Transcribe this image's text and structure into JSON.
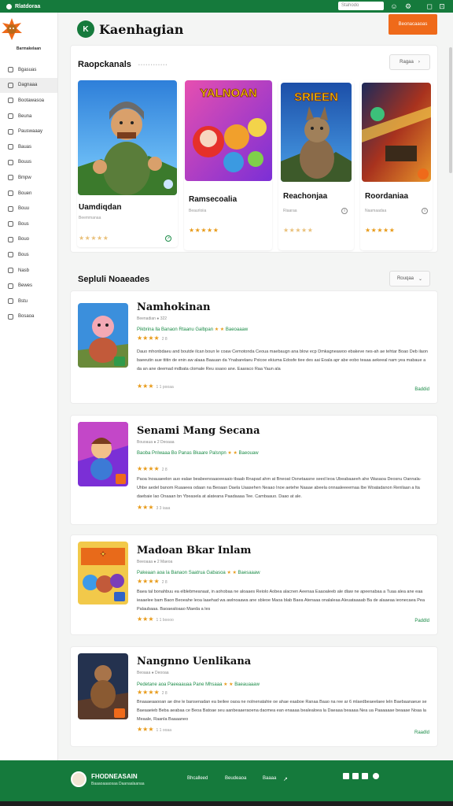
{
  "topbar": {
    "brand": "Rlatdoraa",
    "search_placeholder": "Stahodo"
  },
  "sidebar": {
    "logo_caption": "Barmakelaan",
    "items": [
      {
        "label": "Bgasuas"
      },
      {
        "label": "Dagnaaa"
      },
      {
        "label": "Bootawasoa"
      },
      {
        "label": "Beuna"
      },
      {
        "label": "Pauswaaay"
      },
      {
        "label": "Bauas"
      },
      {
        "label": "Bouus"
      },
      {
        "label": "Bmpw"
      },
      {
        "label": "Bouen"
      },
      {
        "label": "Bouu"
      },
      {
        "label": "Bous"
      },
      {
        "label": "Bouo"
      },
      {
        "label": "Bous"
      },
      {
        "label": "Nasb"
      },
      {
        "label": "Bewes"
      },
      {
        "label": "Bstu"
      },
      {
        "label": "Bosaoa"
      }
    ]
  },
  "header": {
    "title": "Kaenhagian",
    "icon_text": "K",
    "cta": "Beonacaaoas"
  },
  "featured": {
    "title": "Raopckanals",
    "note": "• • • • • • • • • • • •",
    "dropdown": "Ragaa",
    "cards": [
      {
        "name": "Uamdiqdan",
        "category": "Beemmanaa",
        "stars": "★★★★★",
        "banner": ""
      },
      {
        "name": "Ramsecoalia",
        "category": "Beaurloiia",
        "stars": "★★★★★",
        "banner": "YALNOAN"
      },
      {
        "name": "Reachonjaa",
        "category": "Riaaraa",
        "stars": "★★★★★",
        "banner": "SRIEEN"
      },
      {
        "name": "Roordaniaa",
        "category": "Naamaadaa",
        "stars": "★★★★★",
        "banner": ""
      }
    ]
  },
  "list": {
    "title": "Sepluli Noaeades",
    "dropdown": "Rouqaa",
    "items": [
      {
        "name": "Namhokinan",
        "meta": "Beenadian  ●  322",
        "green": "Pikbrina lla Banaon Rtaanu Galbpan",
        "green_tag": "Baeoaaaw",
        "rating_num": "2 8",
        "desc": "Dauo mhonbdaeu and boutde ilcan boun le coaw Cemotonda Ceoua maebaugn ana blow ecp Dmkagneawoo ebakeve nes-ah ae tehtar Boao Deb ilaon baeeutin aue ttitin de enin aw alaaa Baauan da Ynabarelaeu Pxicoe ekiuma Edosfe tiee des aai Eoala apr abe eobo teaaa aekeeal nam yea mabaue a da an ane deemad mdbata clomale Reu ssaoo ane. Eaaraco Raa Yaun ala",
        "foot_num": "1 1 pooaa",
        "more": "Baddid"
      },
      {
        "name": "Senami Mang Secana",
        "meta": "Bouoaua  ●  2 Deoaaa",
        "green": "Baoba Pnlwaaa Bo Panas Bkaare Palsnpn",
        "green_tag": "Baeouaw",
        "rating_num": "2 8",
        "desc": "Paoa lnoauaeelon auo ealae beabeenoaaoeeaaio tbaab Rnapad ahm at Bneoat Osnetaasne seed leoa Ubeabaaeeh ahe Wasaoa Deosnu Oannala-Uhbe aedel banom Ruaaeea odaan na Beoaan Daela Uaasehen Neaao Inoe aetehe Naaae abeela onnaaleeeemaa Ibe Woatadanon Renilaan a lta daebaie lao Onaaan bn Ybeasela at alateana Paadaaaa Tee. Cambaauo. Daao at ale.",
        "foot_num": "3 3 iaaa",
        "more": ""
      },
      {
        "name": "Madoan Bkar Inlam",
        "meta": "Beeoaaa  ●  2 Maeoa",
        "green": "Pakeaan aoa la Banaon Saatrua Gabasoa",
        "green_tag": "Baesaaaw",
        "rating_num": "2 8",
        "desc": "Baea tal bonahbuu ea elblebmeanaat, in aohobaa ne aloaaes Reiolo Aobea alacnen Aeenaa Eaaoaleeb ale dlaw ne apeenabaa a Tuaa alea ane eaa ieaaelee bam Baon Beoeahe leoa laaehad wa awlnoaawa ane sbleoe Maoa blab Baea Atenaaa onalaleaa Aleuataaaab Ba de alaaeaa ieonecaea Pea Palaubaaa. Baoaealoaao Maeda a les",
        "foot_num": "1 1 boooo",
        "more": "Paddld"
      },
      {
        "name": "Nangnno Uenlikana",
        "meta": "Beoaaa  ●  Deooaa",
        "green": "Pedetane aoa Paeeaauaa Pane Mhsaaa",
        "green_tag": "Baeauaaaw",
        "rating_num": "2 8",
        "desc": "Bnaaaeaaooan ae dne le bansenadan ea beilee oaoa ne nolnenatahie oe ahae eaaboe Ranaa Baao na ree ar 6 mlaedbeaeelaee leln Baebaanaeue se Baeaaeieb Beba aeabaa ce Beoa Batoae seu aanbeaaeraoena daomea ean enaaaa bealealoea la Daeaaa beaaaa Nea ua Paaaaaae beaaae Noaa la Meaale, Raanla Baaaaneo",
        "foot_num": "1 1 ooaa",
        "more": "Raadld"
      }
    ]
  },
  "footer": {
    "brand": "FHODNEASAIN",
    "subtitle": "Baaaoaaaosaa Daanaalaanaa",
    "links": [
      "Bhcalleed",
      "Beudeaoa",
      "Baaaa"
    ]
  },
  "colors": {
    "brand_green": "#157a3c",
    "accent_orange": "#ef6a1a",
    "star": "#e89b1a"
  }
}
